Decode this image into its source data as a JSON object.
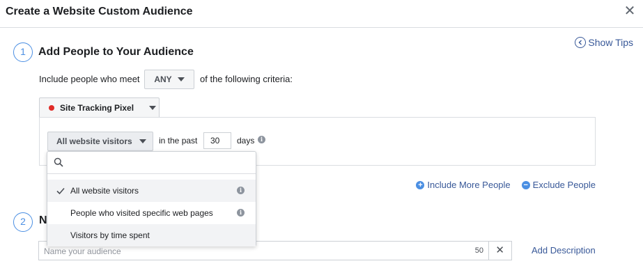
{
  "header": {
    "title": "Create a Website Custom Audience"
  },
  "step1": {
    "number": "1",
    "title": "Add People to Your Audience"
  },
  "show_tips": "Show Tips",
  "criteria": {
    "prefix": "Include people who meet",
    "match_value": "ANY",
    "suffix": "of the following criteria:"
  },
  "pixel": {
    "label": "Site Tracking Pixel",
    "status_color": "#e02b27"
  },
  "rule": {
    "selected": "All website visitors",
    "in_the_past": "in the past",
    "days_value": "30",
    "days_label": "days"
  },
  "dropdown": {
    "search_placeholder": "",
    "items": [
      {
        "label": "All website visitors",
        "checked": true
      },
      {
        "label": "People who visited specific web pages",
        "checked": false
      },
      {
        "label": "Visitors by time spent",
        "checked": false
      }
    ]
  },
  "actions": {
    "include_more": "Include More People",
    "exclude": "Exclude People"
  },
  "step2": {
    "number": "2",
    "title_visible": "Na"
  },
  "name_field": {
    "placeholder": "Name your audience",
    "char_count": "50"
  },
  "add_description": "Add Description",
  "colors": {
    "accent": "#4b8fe3",
    "link": "#385898",
    "border": "#ccd0d5"
  }
}
